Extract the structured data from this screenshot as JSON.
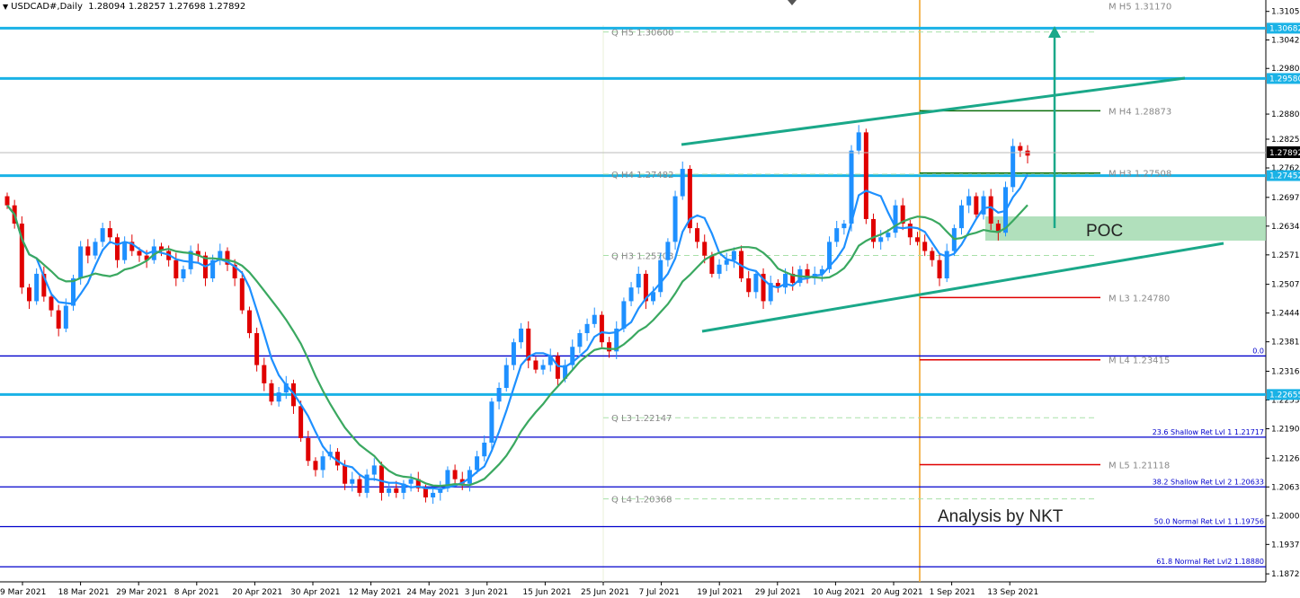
{
  "header": {
    "symbol": "USDCAD#,Daily",
    "ohlc": "1.28094 1.28257 1.27698 1.27892"
  },
  "chart_data": {
    "type": "candlestick",
    "symbol": "USDCAD#",
    "timeframe": "Daily",
    "ylim": [
      1.1855,
      1.313
    ],
    "price_ticks": [
      "1.31050",
      "1.30425",
      "1.29800",
      "1.28800",
      "1.28250",
      "1.27620",
      "1.26975",
      "1.26345",
      "1.25715",
      "1.25070",
      "1.24440",
      "1.23810",
      "1.23165",
      "1.22535",
      "1.21905",
      "1.21260",
      "1.20630",
      "1.20000",
      "1.19370",
      "1.18725"
    ],
    "date_labels": [
      "9 Mar 2021",
      "18 Mar 2021",
      "29 Mar 2021",
      "8 Apr 2021",
      "20 Apr 2021",
      "30 Apr 2021",
      "12 May 2021",
      "24 May 2021",
      "3 Jun 2021",
      "15 Jun 2021",
      "25 Jun 2021",
      "7 Jul 2021",
      "19 Jul 2021",
      "29 Jul 2021",
      "10 Aug 2021",
      "20 Aug 2021",
      "1 Sep 2021",
      "13 Sep 2021"
    ],
    "current_price": "1.27892",
    "price_tags": [
      {
        "label": "1.30682",
        "value": 1.30682,
        "color": "#1ab2e6"
      },
      {
        "label": "1.29580",
        "value": 1.2958,
        "color": "#1ab2e6"
      },
      {
        "label": "1.27452",
        "value": 1.27452,
        "color": "#1ab2e6"
      },
      {
        "label": "1.22655",
        "value": 1.22655,
        "color": "#1ab2e6"
      }
    ],
    "horizontal_levels": [
      {
        "value": 1.30682,
        "color": "#1ab2e6"
      },
      {
        "value": 1.2958,
        "color": "#1ab2e6"
      },
      {
        "value": 1.27452,
        "color": "#1ab2e6"
      },
      {
        "value": 1.22655,
        "color": "#1ab2e6"
      },
      {
        "value": 1.235,
        "color": "#0000cc",
        "label": "0.0"
      },
      {
        "value": 1.2172,
        "color": "#0000cc",
        "label": "23.6 Shallow Ret Lvl 1 1.21717"
      },
      {
        "value": 1.2063,
        "color": "#0000cc",
        "label": "38.2 Shallow Ret Lvl 2 1.20633"
      },
      {
        "value": 1.1976,
        "color": "#0000cc",
        "label": "50.0 Normal Ret Lvl 1 1.19756"
      },
      {
        "value": 1.1888,
        "color": "#0000cc",
        "label": "61.8 Normal Ret Lvl2 1.18880"
      }
    ],
    "quarterly_pivots": [
      {
        "label": "Q  H5 1.30600",
        "value": 1.306
      },
      {
        "label": "Q  H4 1.27482",
        "value": 1.27482
      },
      {
        "label": "Q  H3 1.25703",
        "value": 1.25703
      },
      {
        "label": "Q  L3 1.22147",
        "value": 1.22147
      },
      {
        "label": "Q  L4 1.20368",
        "value": 1.20368
      }
    ],
    "monthly_pivots": [
      {
        "label": "M  H5 1.31170",
        "value": 1.3117,
        "color": "#cccccc"
      },
      {
        "label": "M  H4 1.28873",
        "value": 1.28873,
        "color": "#0a6e0a"
      },
      {
        "label": "M  H3 1.27508",
        "value": 1.27508,
        "color": "#0a6e0a"
      },
      {
        "label": "M  L3 1.24780",
        "value": 1.2478,
        "color": "#e00000"
      },
      {
        "label": "M  L4 1.23415",
        "value": 1.23415,
        "color": "#e00000"
      },
      {
        "label": "M  L5 1.21118",
        "value": 1.21118,
        "color": "#e00000"
      }
    ],
    "annotations": {
      "poc": "POC",
      "author": "Analysis by NKT",
      "channel_color": "#1aa889",
      "period_separator_color": "#f0a020"
    },
    "bull_color": "#1e90ff",
    "bear_color": "#e00000",
    "ma_fast_color": "#1e90ff",
    "ma_slow_color": "#3aa860"
  }
}
